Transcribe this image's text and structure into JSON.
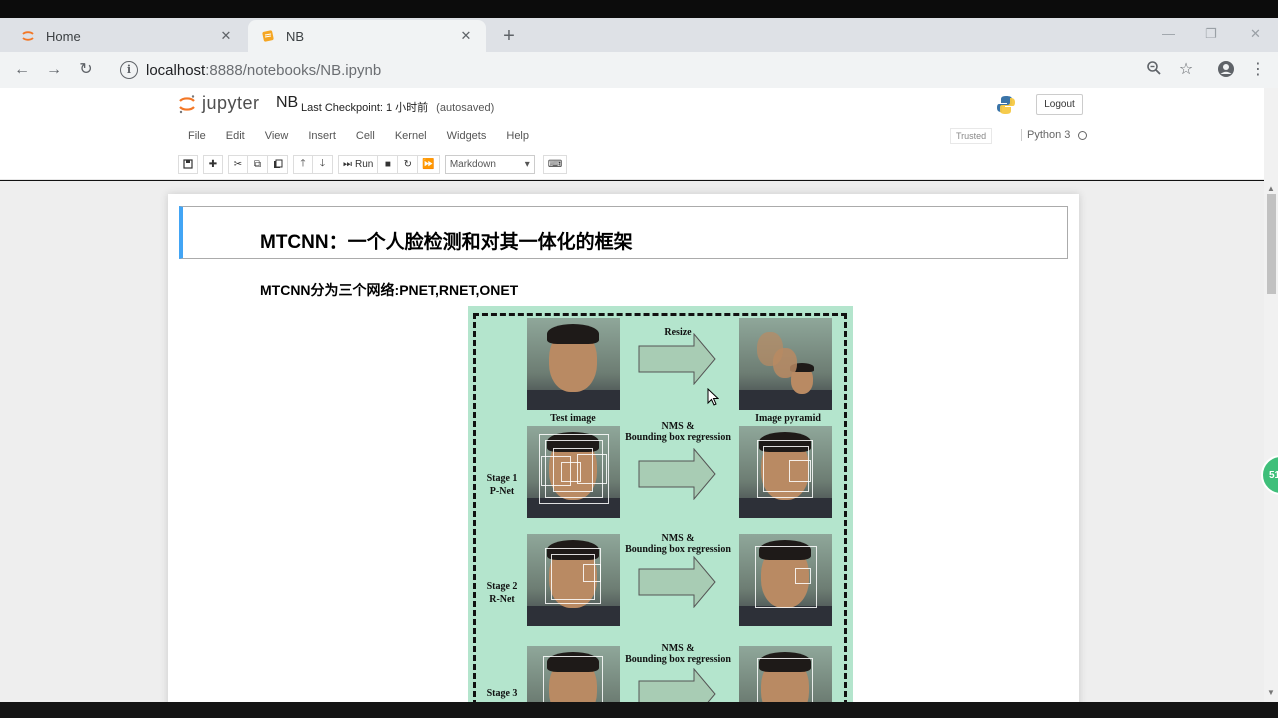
{
  "browser": {
    "tabs": [
      {
        "title": "Home",
        "active": false
      },
      {
        "title": "NB",
        "active": true
      }
    ],
    "new_tab": "+",
    "url_host": "localhost",
    "url_rest": ":8888/notebooks/NB.ipynb"
  },
  "jupyter": {
    "logo_text": "jupyter",
    "notebook_name": "NB",
    "checkpoint": "Last Checkpoint: 1 小时前",
    "autosaved": "(autosaved)",
    "logout": "Logout",
    "menu": [
      "File",
      "Edit",
      "View",
      "Insert",
      "Cell",
      "Kernel",
      "Widgets",
      "Help"
    ],
    "trusted": "Trusted",
    "kernel_name": "Python 3",
    "run_label": "Run",
    "cell_type": "Markdown"
  },
  "notebook": {
    "heading": "MTCNN：一个人脸检测和对其一体化的框架",
    "subheading": "MTCNN分为三个网络:PNET,RNET,ONET"
  },
  "figure": {
    "resize_label": "Resize",
    "test_image_label": "Test image",
    "pyramid_label": "Image pyramid",
    "nms_label_1": "NMS &",
    "nms_label_2": "Bounding box regression",
    "stage1": "Stage 1",
    "stage1_net": "P-Net",
    "stage2": "Stage 2",
    "stage2_net": "R-Net",
    "stage3": "Stage 3"
  },
  "side_badge": "51",
  "colors": {
    "figure_bg": "#b4e5cd",
    "selected_cell_accent": "#42a5f5",
    "jupyter_orange": "#f37726"
  }
}
